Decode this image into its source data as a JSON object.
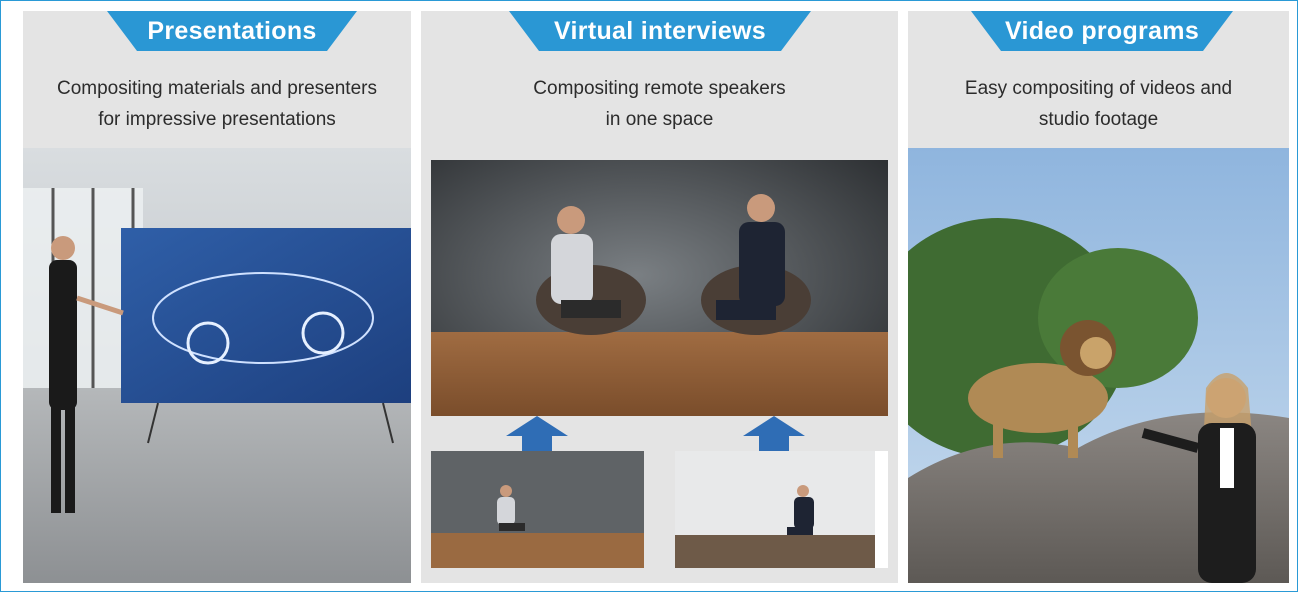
{
  "panels": [
    {
      "title": "Presentations",
      "description": "Compositing materials and presenters\nfor impressive presentations"
    },
    {
      "title": "Virtual interviews",
      "description": "Compositing remote speakers\nin one space"
    },
    {
      "title": "Video programs",
      "description": "Easy compositing of videos and\nstudio footage"
    }
  ],
  "colors": {
    "accent": "#2a97d4",
    "panel_bg": "#e4e4e4",
    "arrow": "#2f6db5"
  },
  "icons": [
    "up-arrow-icon",
    "up-arrow-icon"
  ]
}
